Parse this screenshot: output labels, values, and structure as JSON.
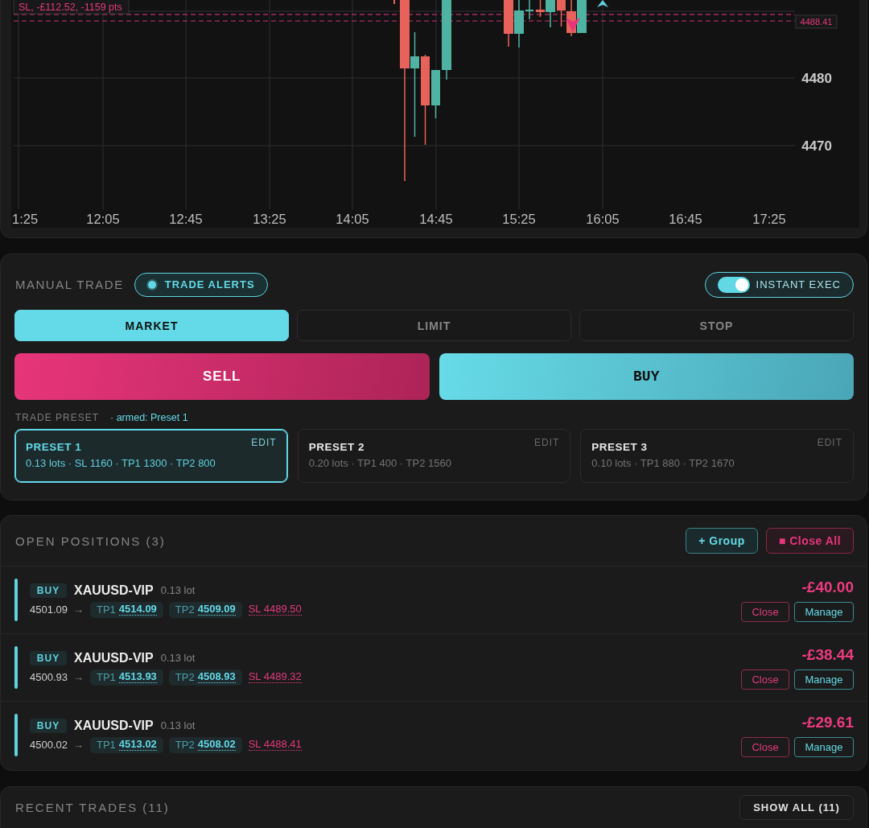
{
  "chart": {
    "stop_loss_label": "SL, -£112.52, -1159 pts",
    "price_tag": "4488.41",
    "price_labels": [
      "4480",
      "4470"
    ],
    "time_labels": [
      "1:25",
      "12:05",
      "12:45",
      "13:25",
      "14:05",
      "14:45",
      "15:25",
      "16:05",
      "16:45",
      "17:25"
    ]
  },
  "manual_trade": {
    "title": "MANUAL TRADE",
    "trade_alerts": {
      "label": "TRADE ALERTS",
      "on": true
    },
    "instant_exec": {
      "label": "INSTANT EXEC",
      "on": true
    },
    "order_types": [
      {
        "label": "MARKET",
        "selected": true
      },
      {
        "label": "LIMIT",
        "selected": false
      },
      {
        "label": "STOP",
        "selected": false
      }
    ],
    "sell_button": "SELL",
    "buy_button": "BUY",
    "preset_heading": "TRADE PRESET",
    "armed_note": "· armed: Preset 1",
    "presets": [
      {
        "title": "PRESET 1",
        "edit": "EDIT",
        "details": "0.13 lots · SL 1160 · TP1 1300 · TP2 800",
        "selected": true
      },
      {
        "title": "PRESET 2",
        "edit": "EDIT",
        "details": "0.20 lots · TP1 400 · TP2 1560",
        "selected": false
      },
      {
        "title": "PRESET 3",
        "edit": "EDIT",
        "details": "0.10 lots · TP1 880 · TP2 1670",
        "selected": false
      }
    ]
  },
  "open_positions": {
    "title": "OPEN POSITIONS (3)",
    "group_button": "+ Group",
    "close_all_button": "■ Close All",
    "positions": [
      {
        "side": "BUY",
        "symbol": "XAUUSD-VIP",
        "lot": "0.13 lot",
        "entry": "4501.09",
        "arrow": "→",
        "tp1": {
          "label": "TP1",
          "value": "4514.09"
        },
        "tp2": {
          "label": "TP2",
          "value": "4509.09"
        },
        "sl": "SL 4489.50",
        "pnl": "-£40.00",
        "close_button": "Close",
        "manage_button": "Manage"
      },
      {
        "side": "BUY",
        "symbol": "XAUUSD-VIP",
        "lot": "0.13 lot",
        "entry": "4500.93",
        "arrow": "→",
        "tp1": {
          "label": "TP1",
          "value": "4513.93"
        },
        "tp2": {
          "label": "TP2",
          "value": "4508.93"
        },
        "sl": "SL 4489.32",
        "pnl": "-£38.44",
        "close_button": "Close",
        "manage_button": "Manage"
      },
      {
        "side": "BUY",
        "symbol": "XAUUSD-VIP",
        "lot": "0.13 lot",
        "entry": "4500.02",
        "arrow": "→",
        "tp1": {
          "label": "TP1",
          "value": "4513.02"
        },
        "tp2": {
          "label": "TP2",
          "value": "4508.02"
        },
        "sl": "SL 4488.41",
        "pnl": "-£29.61",
        "close_button": "Close",
        "manage_button": "Manage"
      }
    ]
  },
  "recent_trades": {
    "title": "RECENT TRADES (11)",
    "show_all_button": "SHOW ALL (11)"
  }
}
